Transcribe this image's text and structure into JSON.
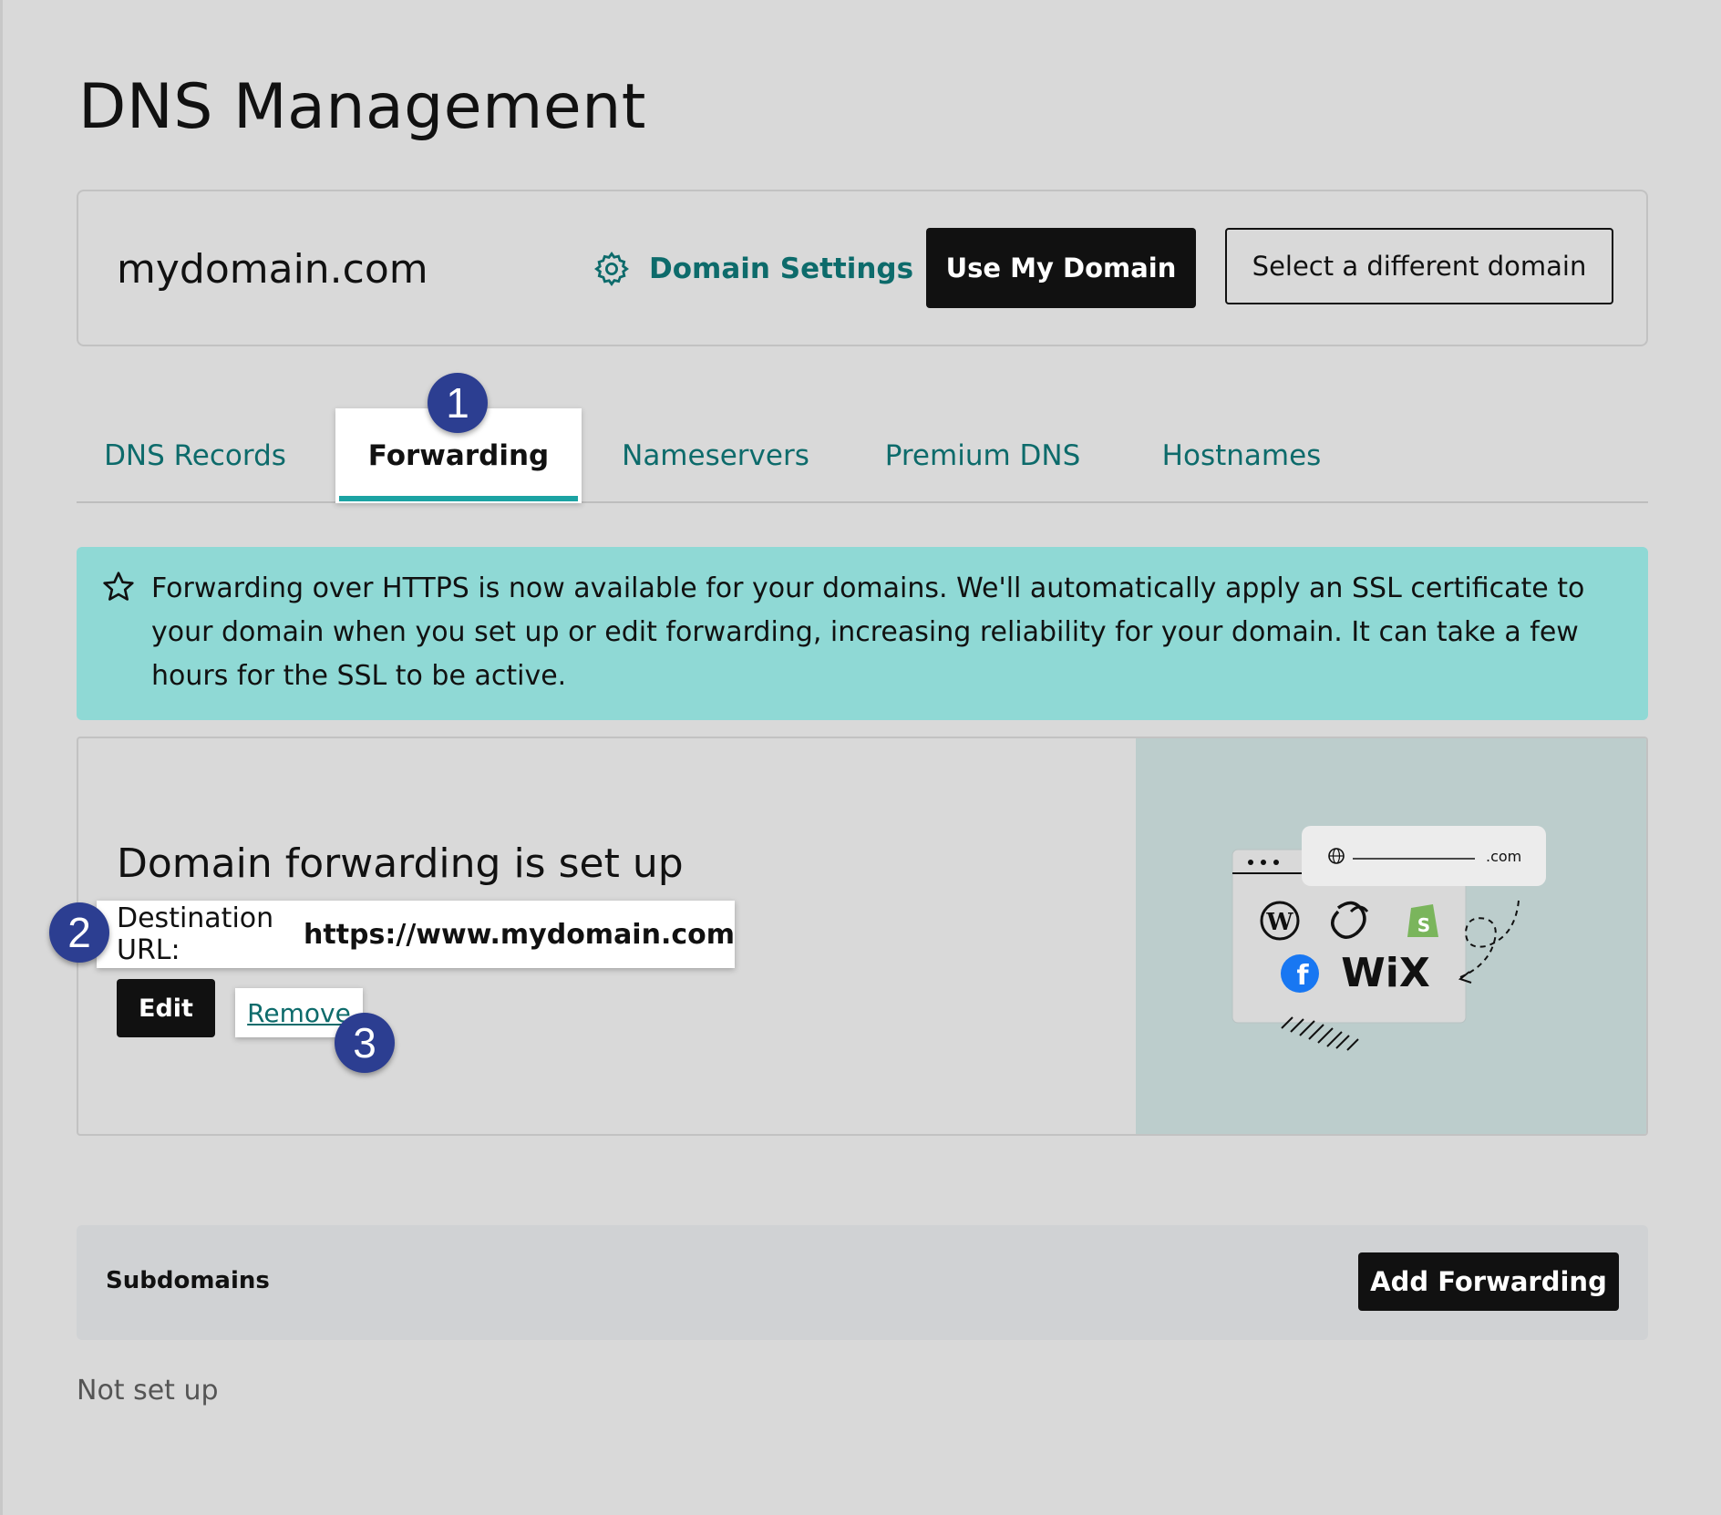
{
  "page": {
    "title": "DNS Management"
  },
  "domain_card": {
    "domain_name": "mydomain.com",
    "settings_label": "Domain Settings",
    "use_domain_label": "Use My Domain",
    "select_domain_label": "Select a different domain"
  },
  "tabs": [
    {
      "label": "DNS Records",
      "active": false
    },
    {
      "label": "Forwarding",
      "active": true
    },
    {
      "label": "Nameservers",
      "active": false
    },
    {
      "label": "Premium DNS",
      "active": false
    },
    {
      "label": "Hostnames",
      "active": false
    }
  ],
  "badges": {
    "one": "1",
    "two": "2",
    "three": "3"
  },
  "banner": {
    "icon": "star-icon",
    "text": "Forwarding over HTTPS is now available for your domains. We'll automatically apply an SSL certificate to your domain when you set up or edit forwarding, increasing reliability for your domain. It can take a few hours for the SSL to be active."
  },
  "forwarding": {
    "title": "Domain forwarding is set up",
    "destination_label": "Destination URL:",
    "destination_value": "https://www.mydomain.com",
    "edit_label": "Edit",
    "remove_label": "Remove",
    "illustration": {
      "url_suffix": ".com",
      "logos": [
        "wordpress-logo",
        "godaddy-logo",
        "shopify-logo",
        "facebook-logo",
        "wix-logo"
      ],
      "wix_text": "WiX"
    }
  },
  "subdomains": {
    "title": "Subdomains",
    "add_label": "Add Forwarding",
    "status": "Not set up"
  },
  "colors": {
    "background": "#d9d9d9",
    "accent_teal": "#0d6b6b",
    "tab_underline": "#1ba3a3",
    "banner_bg": "#8fd9d5",
    "badge_bg": "#2c3e91",
    "illustration_bg": "#bccdcc",
    "button_dark": "#111111"
  }
}
